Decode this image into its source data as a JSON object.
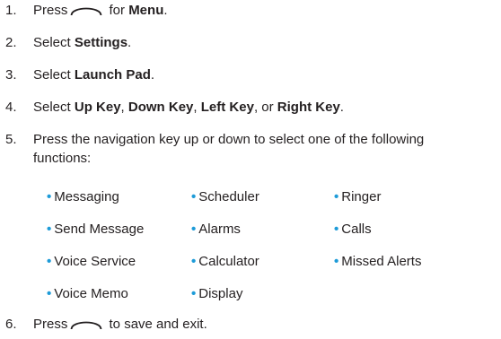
{
  "steps": [
    {
      "num": "1.",
      "pre": "Press",
      "post": " for ",
      "bold": "Menu",
      "end": "."
    },
    {
      "num": "2.",
      "pre": "Select ",
      "bold": "Settings",
      "end": "."
    },
    {
      "num": "3.",
      "pre": "Select ",
      "bold": "Launch Pad",
      "end": "."
    },
    {
      "num": "4.",
      "pre": "Select ",
      "b1": "Up Key",
      "s1": ", ",
      "b2": "Down Key",
      "s2": ", ",
      "b3": "Left Key",
      "s3": ", or ",
      "b4": "Right Key",
      "end": "."
    },
    {
      "num": "5.",
      "line1": "Press the navigation key up or down to select one of the following",
      "line2": "functions:"
    },
    {
      "num": "6.",
      "pre": "Press",
      "post": " to save and exit."
    }
  ],
  "functions": {
    "col1": [
      "Messaging",
      "Send Message",
      "Voice Service",
      "Voice Memo"
    ],
    "col2": [
      "Scheduler",
      "Alarms",
      "Calculator",
      "Display"
    ],
    "col3": [
      "Ringer",
      "Calls",
      "Missed Alerts"
    ]
  },
  "bullet_symbol": "•",
  "bullet_color": "#1d9bd8",
  "icons": {
    "soft_key": "soft-key-icon"
  }
}
